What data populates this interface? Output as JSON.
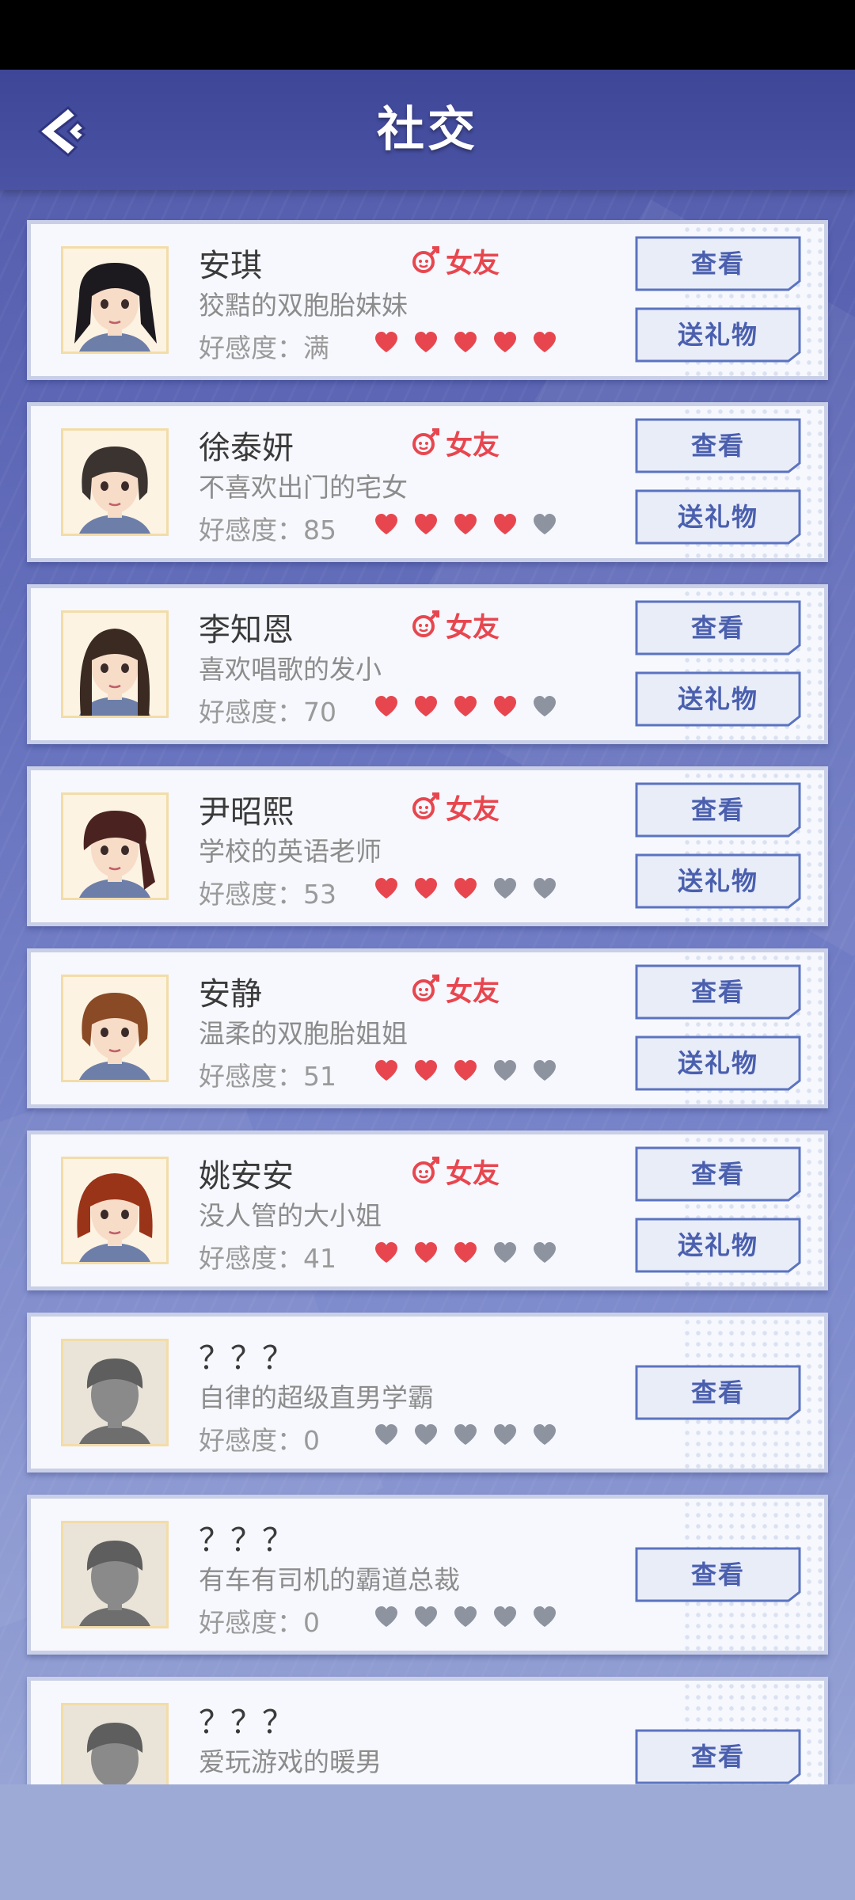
{
  "header": {
    "title": "社交"
  },
  "labels": {
    "view": "查看",
    "gift": "送礼物",
    "girlfriend": "女友",
    "affection_prefix": "好感度："
  },
  "colors": {
    "heart_on": "#e8464f",
    "heart_off": "#8e93a0",
    "button_text": "#4a5fae"
  },
  "characters": [
    {
      "name": "安琪",
      "desc": "狡黠的双胞胎妹妹",
      "affection": "满",
      "hearts": 5,
      "unlocked": true,
      "hair": "#1d1a1f",
      "style": "twin"
    },
    {
      "name": "徐泰妍",
      "desc": "不喜欢出门的宅女",
      "affection": "85",
      "hearts": 4,
      "unlocked": true,
      "hair": "#3b3330",
      "style": "bob"
    },
    {
      "name": "李知恩",
      "desc": "喜欢唱歌的发小",
      "affection": "70",
      "hearts": 4,
      "unlocked": true,
      "hair": "#3a2a22",
      "style": "long"
    },
    {
      "name": "尹昭熙",
      "desc": "学校的英语老师",
      "affection": "53",
      "hearts": 3,
      "unlocked": true,
      "hair": "#4a2320",
      "style": "pony"
    },
    {
      "name": "安静",
      "desc": "温柔的双胞胎姐姐",
      "affection": "51",
      "hearts": 3,
      "unlocked": true,
      "hair": "#8a4a25",
      "style": "bob"
    },
    {
      "name": "姚安安",
      "desc": "没人管的大小姐",
      "affection": "41",
      "hearts": 3,
      "unlocked": true,
      "hair": "#9a3418",
      "style": "curl"
    },
    {
      "name": "？？？",
      "desc": "自律的超级直男学霸",
      "affection": "0",
      "hearts": 0,
      "unlocked": false,
      "hair": "#5e5e5e",
      "style": "male"
    },
    {
      "name": "？？？",
      "desc": "有车有司机的霸道总裁",
      "affection": "0",
      "hearts": 0,
      "unlocked": false,
      "hair": "#5e5e5e",
      "style": "male"
    },
    {
      "name": "？？？",
      "desc": "爱玩游戏的暖男",
      "affection": "",
      "hearts": 0,
      "unlocked": false,
      "hair": "#5e5e5e",
      "style": "male"
    }
  ]
}
